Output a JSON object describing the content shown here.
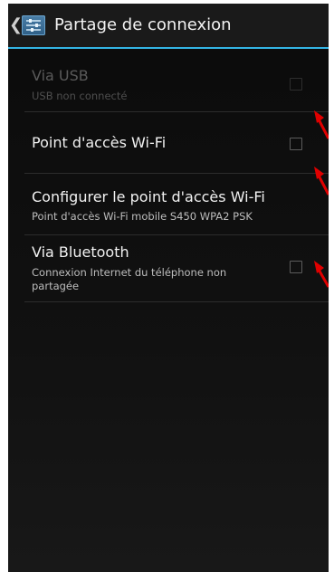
{
  "header": {
    "title": "Partage de connexion",
    "up_caret": "❮",
    "app_icon": "settings-icon"
  },
  "items": [
    {
      "title": "Via USB",
      "summary": "USB non connecté",
      "enabled": false,
      "checked": false
    },
    {
      "title": "Point d'accès Wi-Fi",
      "summary": "",
      "enabled": true,
      "checked": false
    },
    {
      "title": "Configurer le point d'accès Wi-Fi",
      "summary": "Point d'accès Wi-Fi mobile S450 WPA2 PSK",
      "enabled": true
    },
    {
      "title": "Via Bluetooth",
      "summary": "Connexion Internet du téléphone non partagée",
      "enabled": true,
      "checked": false
    }
  ],
  "annotations": {
    "arrow_color": "#e00000"
  },
  "colors": {
    "accent": "#33b5e5",
    "background": "#111111"
  }
}
